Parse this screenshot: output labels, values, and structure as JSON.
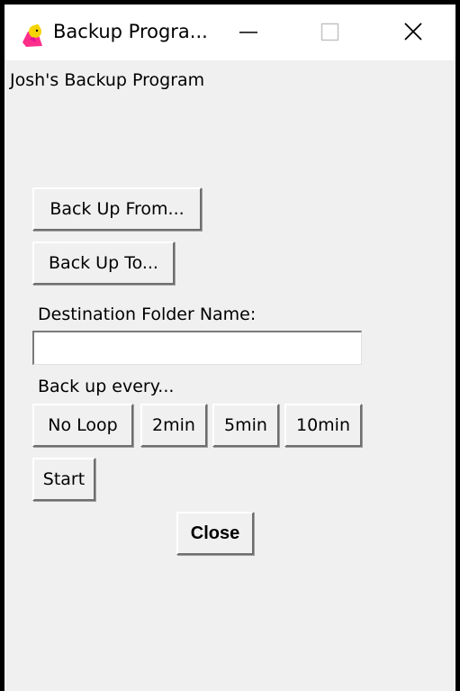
{
  "window": {
    "title": "Backup Progra...",
    "icon": "app-icon"
  },
  "app": {
    "label": "Josh's Backup Program"
  },
  "buttons": {
    "back_up_from": "Back Up From...",
    "back_up_to": "Back Up To...",
    "start": "Start",
    "close": "Close"
  },
  "destination": {
    "label": "Destination Folder Name:",
    "value": "",
    "placeholder": ""
  },
  "interval": {
    "label": "Back up every...",
    "options": [
      "No Loop",
      "2min",
      "5min",
      "10min"
    ]
  },
  "colors": {
    "window_bg": "#f0f0f0",
    "titlebar_bg": "#ffffff",
    "frame": "#000000"
  }
}
